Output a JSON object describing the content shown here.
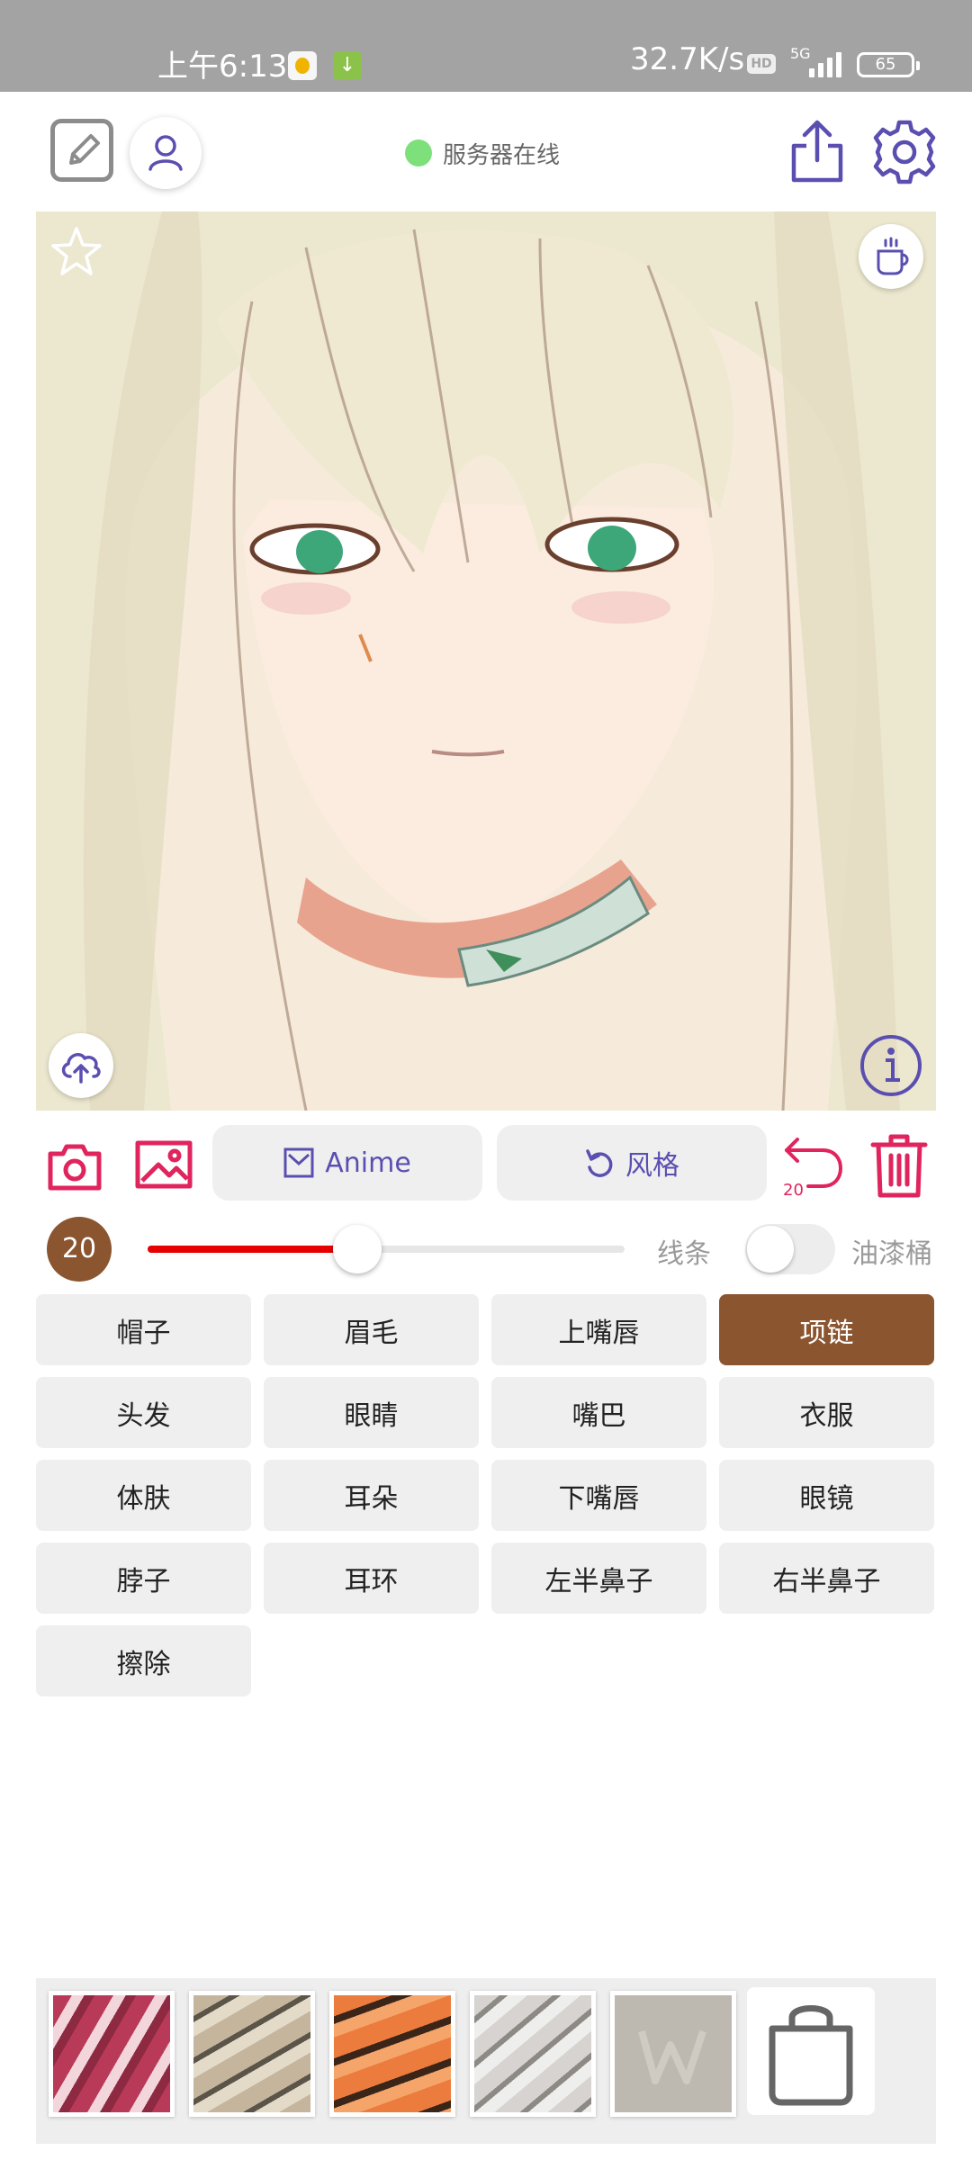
{
  "status_bar": {
    "time": "上午6:13",
    "network_speed": "32.7K/s",
    "hd_badge": "HD",
    "network_type": "5G",
    "battery": "65"
  },
  "top_bar": {
    "server_status": "服务器在线",
    "status_color": "#7ee07a"
  },
  "canvas": {
    "icons": [
      "star-icon",
      "coffee-cup-icon",
      "cloud-upload-icon",
      "info-icon"
    ]
  },
  "actions": {
    "anime_label": "Anime",
    "style_label": "风格",
    "undo_count": "20"
  },
  "brush": {
    "size": "20",
    "slider_level": 0.44,
    "line_label": "线条",
    "bucket_label": "油漆桶",
    "bucket_enabled": false,
    "accent_color": "#e60000"
  },
  "parts": [
    {
      "label": "帽子",
      "selected": false
    },
    {
      "label": "眉毛",
      "selected": false
    },
    {
      "label": "上嘴唇",
      "selected": false
    },
    {
      "label": "项链",
      "selected": true
    },
    {
      "label": "头发",
      "selected": false
    },
    {
      "label": "眼睛",
      "selected": false
    },
    {
      "label": "嘴巴",
      "selected": false
    },
    {
      "label": "衣服",
      "selected": false
    },
    {
      "label": "体肤",
      "selected": false
    },
    {
      "label": "耳朵",
      "selected": false
    },
    {
      "label": "下嘴唇",
      "selected": false
    },
    {
      "label": "眼镜",
      "selected": false
    },
    {
      "label": "脖子",
      "selected": false
    },
    {
      "label": "耳环",
      "selected": false
    },
    {
      "label": "左半鼻子",
      "selected": false
    },
    {
      "label": "右半鼻子",
      "selected": false
    },
    {
      "label": "擦除",
      "selected": false
    }
  ],
  "selected_color": "#8b5530",
  "palette": {
    "swatches": [
      "red-pattern",
      "khaki-pattern",
      "orange-tiger-pattern",
      "silver-pattern",
      "gray-watermark-pattern"
    ],
    "store_icon": "shopping-bag-icon"
  }
}
